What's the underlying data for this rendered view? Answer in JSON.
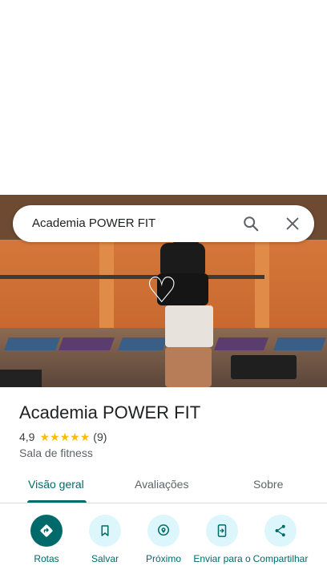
{
  "search": {
    "query": "Academia POWER FIT"
  },
  "place": {
    "name": "Academia POWER FIT",
    "rating": "4,9",
    "stars": [
      "★",
      "★",
      "★",
      "★",
      "★"
    ],
    "reviews_count": "(9)",
    "category": "Sala de fitness"
  },
  "tabs": [
    {
      "label": "Visão geral",
      "active": true
    },
    {
      "label": "Avaliações",
      "active": false
    },
    {
      "label": "Sobre",
      "active": false
    }
  ],
  "actions": [
    {
      "label": "Rotas",
      "icon": "directions-icon"
    },
    {
      "label": "Salvar",
      "icon": "bookmark-icon"
    },
    {
      "label": "Próximo",
      "icon": "nearby-icon"
    },
    {
      "label": "Enviar para o",
      "icon": "send-to-phone-icon"
    },
    {
      "label": "Compartilhar",
      "icon": "share-icon"
    }
  ],
  "colors": {
    "accent": "#006a6a",
    "accent_light": "#dcf6fb",
    "star": "#fbbc04"
  }
}
